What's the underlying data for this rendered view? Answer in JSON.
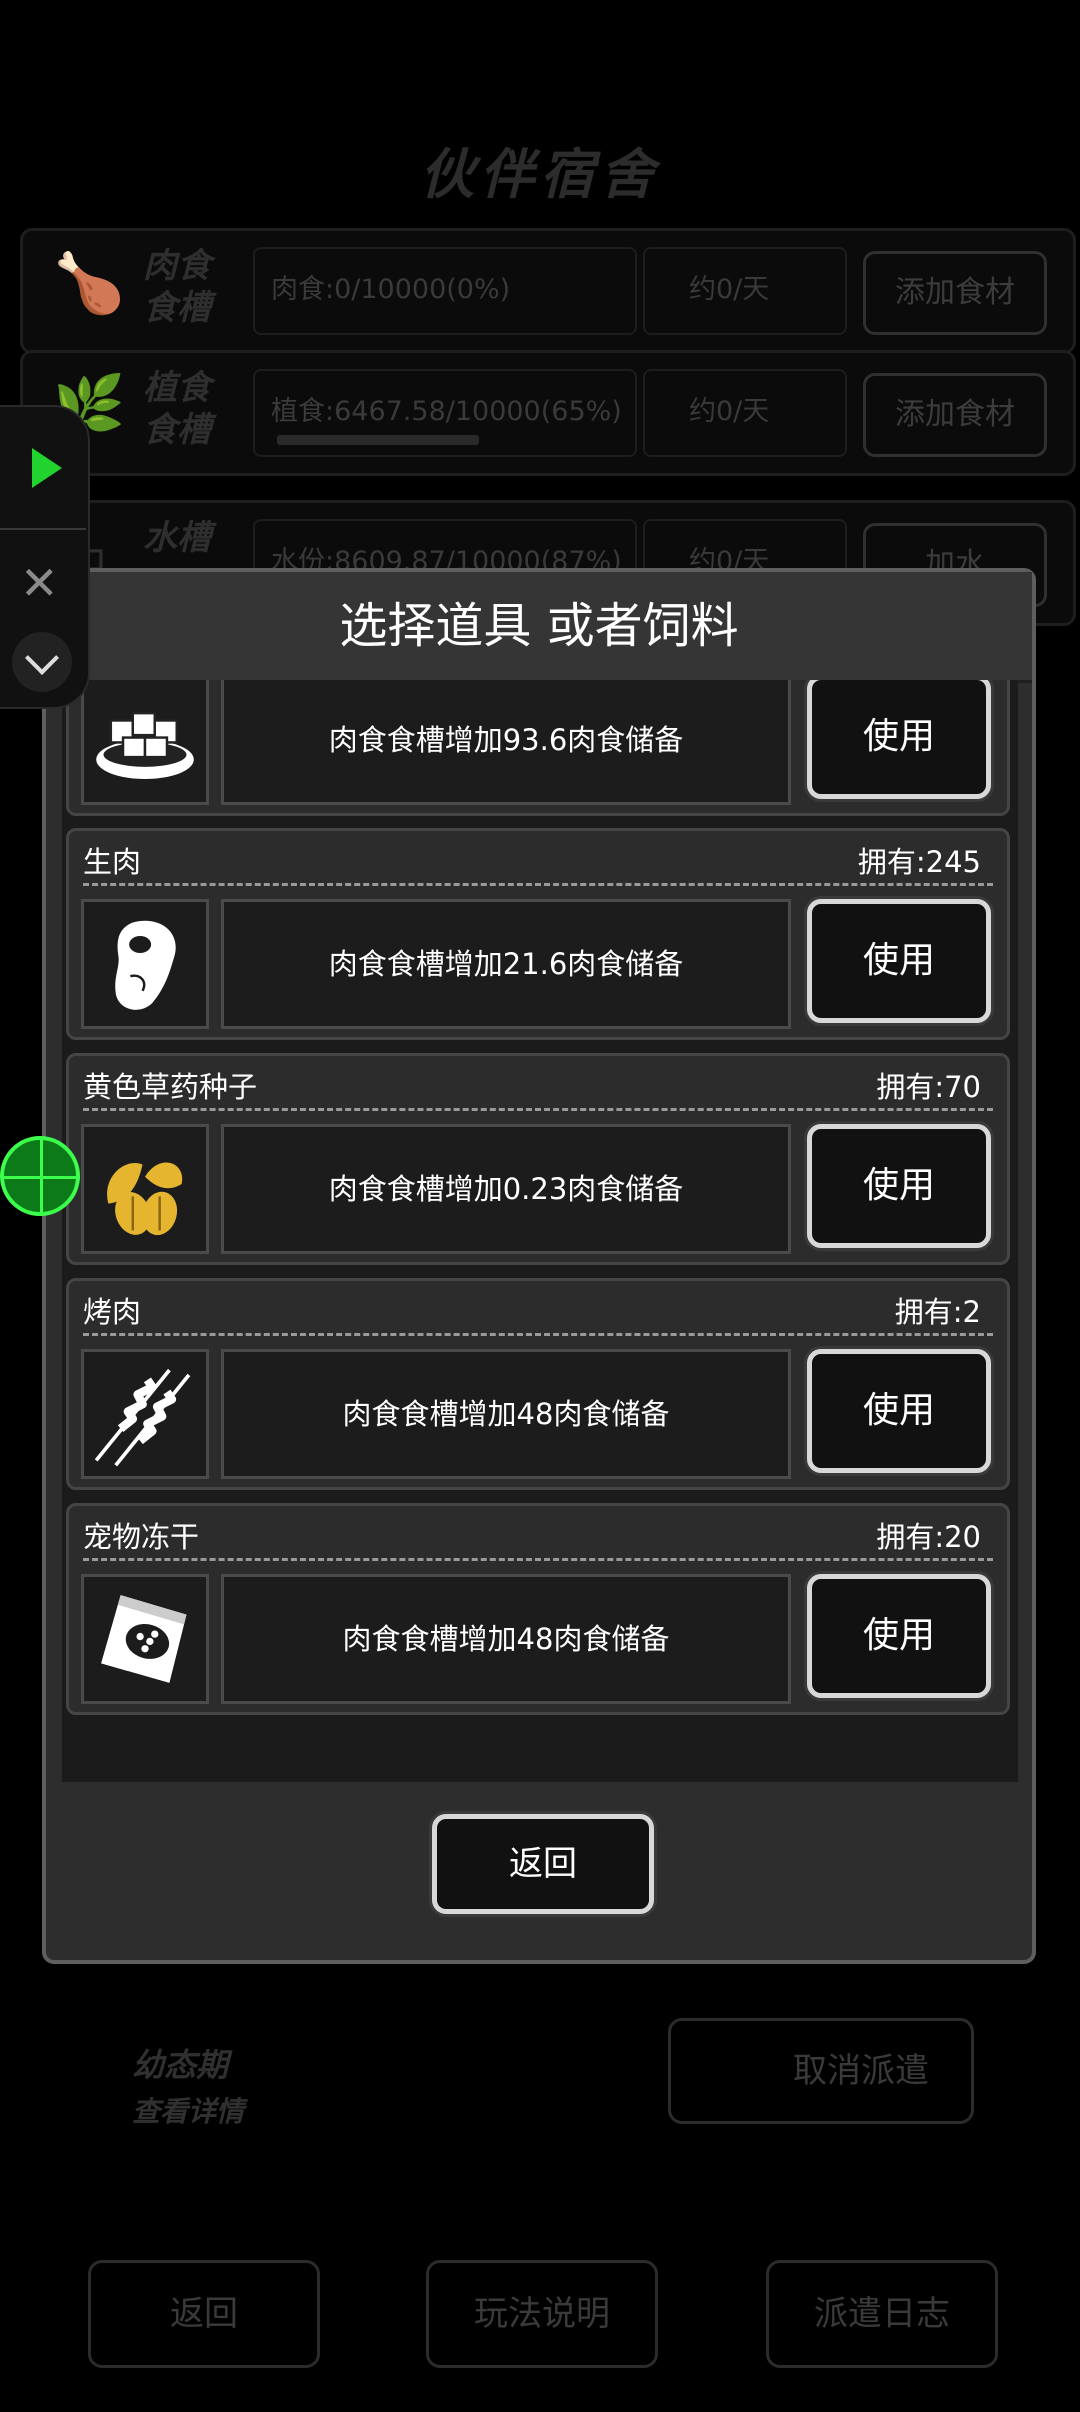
{
  "background": {
    "title": "伙伴宿舍",
    "rows": [
      {
        "label": "肉食食槽",
        "stat": "肉食:0/10000(0%)",
        "rate": "约0/天",
        "button": "添加食材",
        "fill": 0.0
      },
      {
        "label": "植食食槽",
        "stat": "植食:6467.58/10000(65%)",
        "rate": "约0/天",
        "button": "添加食材",
        "fill": 0.65
      },
      {
        "label": "水槽",
        "stat": "水份:8609.87/10000(87%)",
        "rate": "约0/天",
        "button": "加水",
        "fill": 0.87
      }
    ],
    "stage_text": "幼态期",
    "details_text": "查看详情",
    "cancel_dispatch": "取消派遣",
    "bottom_buttons": [
      "返回",
      "玩法说明",
      "派遣日志"
    ]
  },
  "modal": {
    "title": "选择道具 或者饲料",
    "items": [
      {
        "name": "",
        "owned": "",
        "desc": "肉食食槽增加93.6肉食储备",
        "use_label": "使用",
        "icon": "meat-cubes-icon"
      },
      {
        "name": "生肉",
        "owned": "拥有:245",
        "desc": "肉食食槽增加21.6肉食储备",
        "use_label": "使用",
        "icon": "raw-meat-icon"
      },
      {
        "name": "黄色草药种子",
        "owned": "拥有:70",
        "desc": "肉食食槽增加0.23肉食储备",
        "use_label": "使用",
        "icon": "herb-seed-icon"
      },
      {
        "name": "烤肉",
        "owned": "拥有:2",
        "desc": "肉食食槽增加48肉食储备",
        "use_label": "使用",
        "icon": "skewer-icon"
      },
      {
        "name": "宠物冻干",
        "owned": "拥有:20",
        "desc": "肉食食槽增加48肉食储备",
        "use_label": "使用",
        "icon": "pet-food-bag-icon"
      }
    ],
    "back_label": "返回"
  },
  "colors": {
    "accent_green": "#22d22f",
    "modal_bg": "#2d2d2d",
    "button_border": "#d8d8d8",
    "seed_yellow": "#e6b530"
  }
}
